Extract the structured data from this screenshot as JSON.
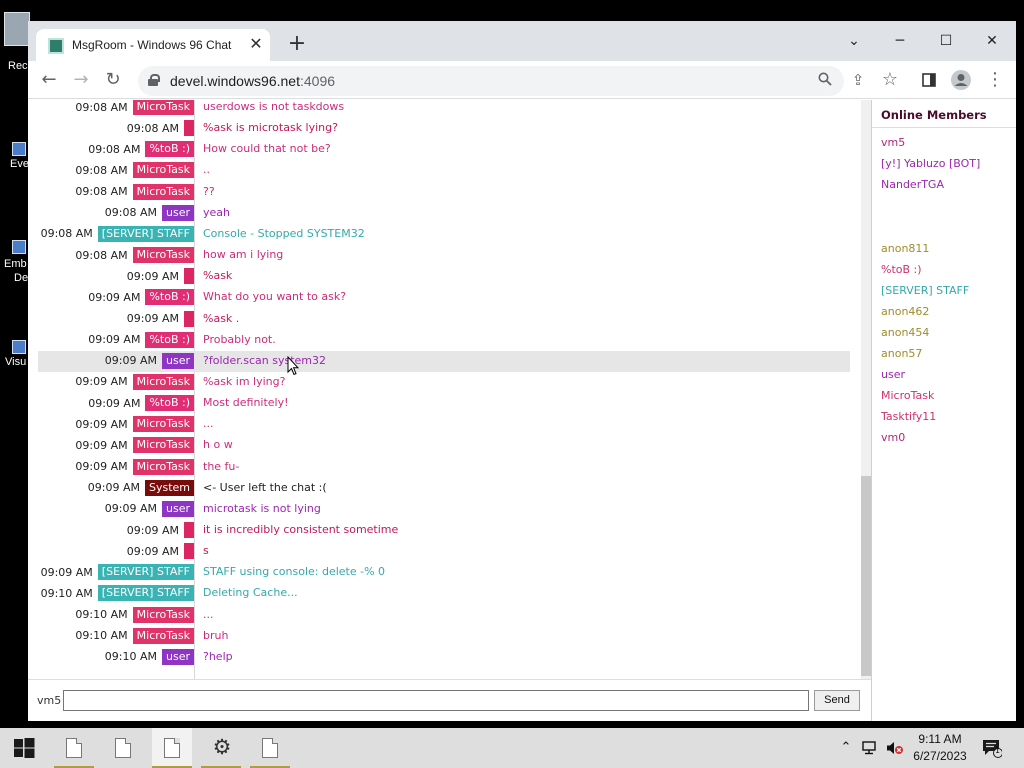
{
  "desktop": {
    "icons": [
      {
        "label": "Rec"
      },
      {
        "label": "Eve"
      },
      {
        "label": "Emb"
      },
      {
        "label": "De"
      },
      {
        "label": "Visu"
      }
    ]
  },
  "browser": {
    "tab_title": "MsgRoom - Windows 96 Chat",
    "url_host": "devel.windows96.net",
    "url_port": ":4096"
  },
  "chat": {
    "messages": [
      {
        "time": "09:08 AM",
        "user": "MicroTask",
        "badge_color": "#e0336a",
        "text": "userdows is not taskdows",
        "text_color": "#cc2c7a"
      },
      {
        "time": "09:08 AM",
        "user": "",
        "badge_color": "#dc2663",
        "text": "%ask is microtask lying?",
        "text_color": "#c2185b"
      },
      {
        "time": "09:08 AM",
        "user": "%toB :)",
        "badge_color": "#e12d74",
        "text": "How could that not be?",
        "text_color": "#cc2c7a"
      },
      {
        "time": "09:08 AM",
        "user": "MicroTask",
        "badge_color": "#e0336a",
        "text": "..",
        "text_color": "#cc2c7a"
      },
      {
        "time": "09:08 AM",
        "user": "MicroTask",
        "badge_color": "#e0336a",
        "text": "??",
        "text_color": "#cc2c7a"
      },
      {
        "time": "09:08 AM",
        "user": "user",
        "badge_color": "#8e35c4",
        "text": "yeah",
        "text_color": "#9c27b0"
      },
      {
        "time": "09:08 AM",
        "user": "[SERVER] STAFF",
        "badge_color": "#39b3b3",
        "text": "Console - Stopped SYSTEM32",
        "text_color": "#34a9a9"
      },
      {
        "time": "09:08 AM",
        "user": "MicroTask",
        "badge_color": "#e0336a",
        "text": "how am i lying",
        "text_color": "#cc2c7a"
      },
      {
        "time": "09:09 AM",
        "user": "",
        "badge_color": "#dc2663",
        "text": "%ask",
        "text_color": "#c2185b"
      },
      {
        "time": "09:09 AM",
        "user": "%toB :)",
        "badge_color": "#e12d74",
        "text": "What do you want to ask?",
        "text_color": "#cc2c7a"
      },
      {
        "time": "09:09 AM",
        "user": "",
        "badge_color": "#dc2663",
        "text": "%ask .",
        "text_color": "#c2185b"
      },
      {
        "time": "09:09 AM",
        "user": "%toB :)",
        "badge_color": "#e12d74",
        "text": "Probably not.",
        "text_color": "#cc2c7a"
      },
      {
        "time": "09:09 AM",
        "user": "user",
        "badge_color": "#8e35c4",
        "text": "?folder.scan system32",
        "text_color": "#9c27b0"
      },
      {
        "time": "09:09 AM",
        "user": "MicroTask",
        "badge_color": "#e0336a",
        "text": "%ask im lying?",
        "text_color": "#cc2c7a"
      },
      {
        "time": "09:09 AM",
        "user": "%toB :)",
        "badge_color": "#e12d74",
        "text": "Most definitely!",
        "text_color": "#cc2c7a"
      },
      {
        "time": "09:09 AM",
        "user": "MicroTask",
        "badge_color": "#e0336a",
        "text": "...",
        "text_color": "#cc2c7a"
      },
      {
        "time": "09:09 AM",
        "user": "MicroTask",
        "badge_color": "#e0336a",
        "text": "h o w",
        "text_color": "#cc2c7a"
      },
      {
        "time": "09:09 AM",
        "user": "MicroTask",
        "badge_color": "#e0336a",
        "text": "the fu-",
        "text_color": "#cc2c7a"
      },
      {
        "time": "09:09 AM",
        "user": "System",
        "badge_color": "#7a0b0b",
        "text": "<- User    left the chat :(",
        "text_color": "#222222"
      },
      {
        "time": "09:09 AM",
        "user": "user",
        "badge_color": "#8e35c4",
        "text": "microtask is not lying",
        "text_color": "#9c27b0"
      },
      {
        "time": "09:09 AM",
        "user": "",
        "badge_color": "#dc2663",
        "text": "it is incredibly consistent sometime",
        "text_color": "#c2185b"
      },
      {
        "time": "09:09 AM",
        "user": "",
        "badge_color": "#dc2663",
        "text": "s",
        "text_color": "#c2185b"
      },
      {
        "time": "09:09 AM",
        "user": "[SERVER] STAFF",
        "badge_color": "#39b3b3",
        "text": "STAFF using console: delete -% 0",
        "text_color": "#34a9a9"
      },
      {
        "time": "09:10 AM",
        "user": "[SERVER] STAFF",
        "badge_color": "#39b3b3",
        "text": "Deleting Cache...",
        "text_color": "#34a9a9"
      },
      {
        "time": "09:10 AM",
        "user": "MicroTask",
        "badge_color": "#e0336a",
        "text": "...",
        "text_color": "#cc2c7a"
      },
      {
        "time": "09:10 AM",
        "user": "MicroTask",
        "badge_color": "#e0336a",
        "text": "bruh",
        "text_color": "#cc2c7a"
      },
      {
        "time": "09:10 AM",
        "user": "user",
        "badge_color": "#8e35c4",
        "text": "?help",
        "text_color": "#9c27b0"
      }
    ],
    "input_nick": "vm5",
    "input_value": "",
    "send_label": "Send"
  },
  "members": {
    "title": "Online Members",
    "list": [
      {
        "name": "vm5",
        "color": "#b0287a"
      },
      {
        "name": "[y!] Yabluzo [BOT]",
        "color": "#9c27b0"
      },
      {
        "name": "NanderTGA",
        "color": "#9c27b0"
      },
      {
        "name": "",
        "color": "#ffffff"
      },
      {
        "name": "",
        "color": "#ffffff"
      },
      {
        "name": "anon811",
        "color": "#a08c2a"
      },
      {
        "name": "%toB :)",
        "color": "#d1306a"
      },
      {
        "name": "[SERVER] STAFF",
        "color": "#34a9a9"
      },
      {
        "name": "anon462",
        "color": "#a08c2a"
      },
      {
        "name": "anon454",
        "color": "#a08c2a"
      },
      {
        "name": "anon57",
        "color": "#a08c2a"
      },
      {
        "name": "user",
        "color": "#9c27b0"
      },
      {
        "name": "MicroTask",
        "color": "#d1306a"
      },
      {
        "name": "Tasktify11",
        "color": "#d1306a"
      },
      {
        "name": "vm0",
        "color": "#b0287a"
      }
    ]
  },
  "taskbar": {
    "time": "9:11 AM",
    "date": "6/27/2023",
    "notification_count": "1"
  }
}
